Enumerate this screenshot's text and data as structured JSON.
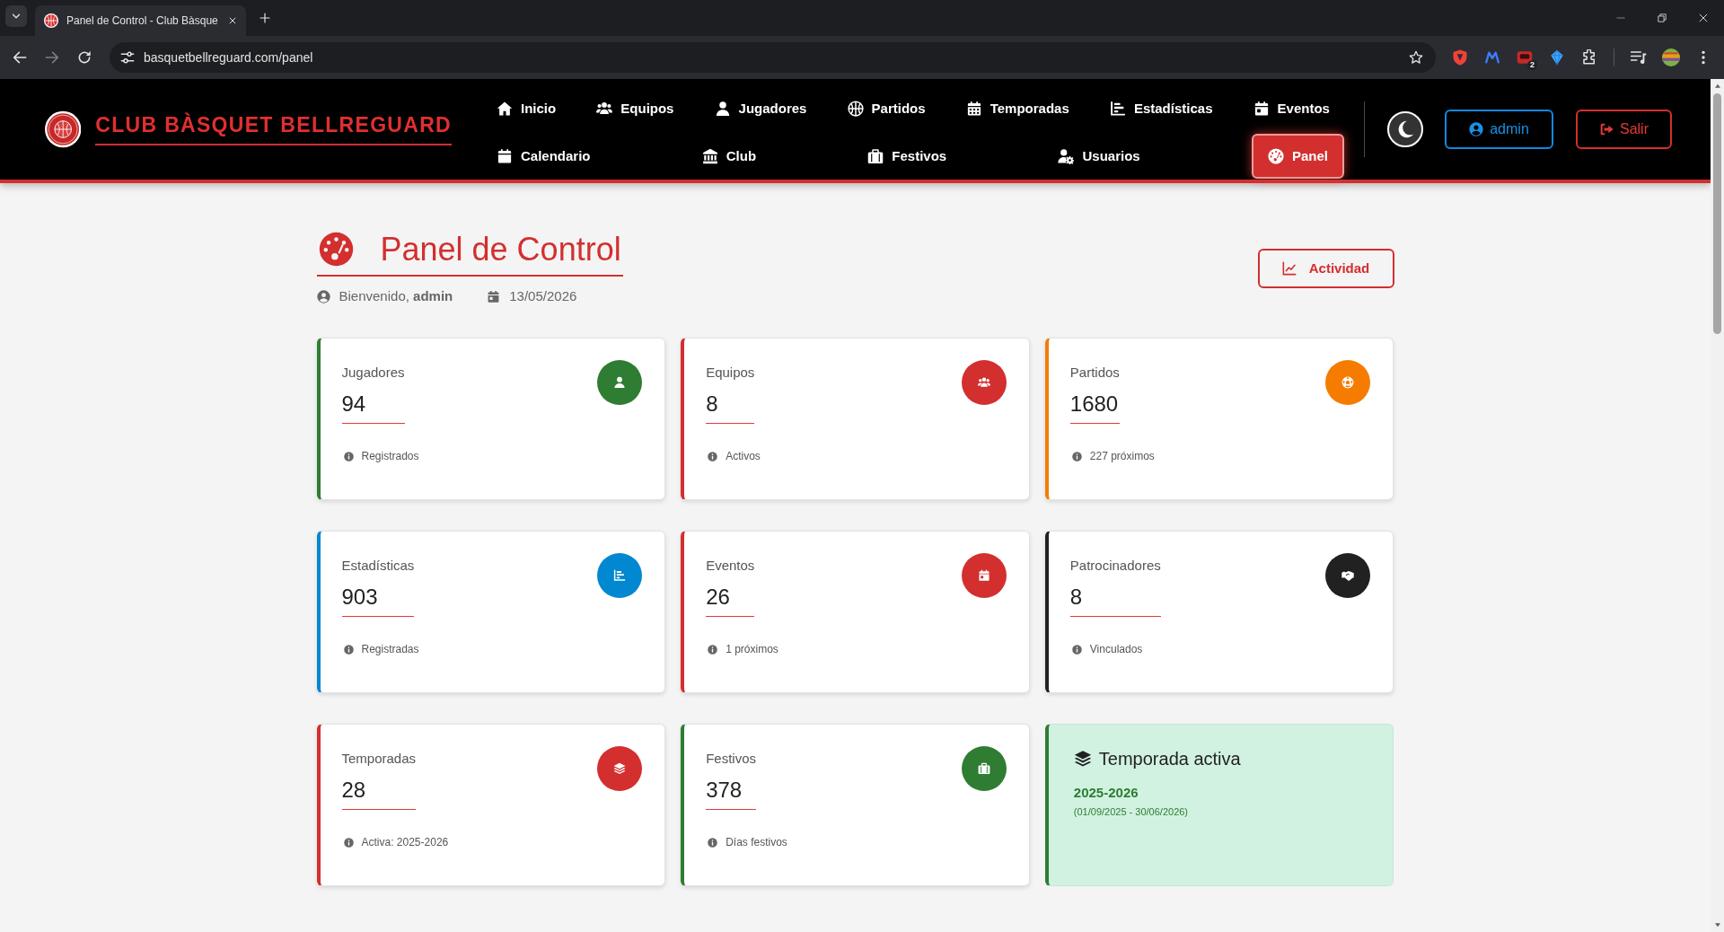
{
  "browser": {
    "tab_title": "Panel de Control - Club Bàsque",
    "url": "basquetbellreguard.com/panel",
    "extension_badge": "2"
  },
  "navbar": {
    "brand": "CLUB BÀSQUET BELLREGUARD",
    "rows": [
      {
        "items": [
          {
            "label": "Inicio",
            "selected": false
          },
          {
            "label": "Equipos",
            "selected": false
          },
          {
            "label": "Jugadores",
            "selected": false
          },
          {
            "label": "Partidos",
            "selected": false
          },
          {
            "label": "Temporadas",
            "selected": false
          },
          {
            "label": "Estadísticas",
            "selected": false
          },
          {
            "label": "Eventos",
            "selected": false
          }
        ]
      },
      {
        "items": [
          {
            "label": "Calendario",
            "selected": false
          },
          {
            "label": "Club",
            "selected": false
          },
          {
            "label": "Festivos",
            "selected": false
          },
          {
            "label": "Usuarios",
            "selected": false
          },
          {
            "label": "Panel",
            "selected": true
          }
        ]
      }
    ],
    "user_button": "admin",
    "logout_button": "Salir"
  },
  "header": {
    "title": "Panel de Control",
    "welcome": "Bienvenido, **admin**",
    "date": "13/05/2026",
    "activity_button": "Actividad"
  },
  "cards": [
    {
      "kind": "stat",
      "label": "Jugadores",
      "value": "94",
      "note": "Registrados",
      "color": "#2e7d32"
    },
    {
      "kind": "stat",
      "label": "Equipos",
      "value": "8",
      "note": "Activos",
      "color": "#d32f2f"
    },
    {
      "kind": "stat",
      "label": "Partidos",
      "value": "1680",
      "note": "227 próximos",
      "color": "#f57c00"
    },
    {
      "kind": "stat",
      "label": "Estadísticas",
      "value": "903",
      "note": "Registradas",
      "color": "#0288d1"
    },
    {
      "kind": "stat",
      "label": "Eventos",
      "value": "26",
      "note": "1 próximos",
      "color": "#d32f2f"
    },
    {
      "kind": "stat",
      "label": "Patrocinadores",
      "value": "8",
      "note": "Vinculados",
      "color": "#212121"
    },
    {
      "kind": "stat",
      "label": "Temporadas",
      "value": "28",
      "note": "Activa: 2025-2026",
      "color": "#d32f2f"
    },
    {
      "kind": "stat",
      "label": "Festivos",
      "value": "378",
      "note": "Días festivos",
      "color": "#2e7d32"
    },
    {
      "kind": "season",
      "title": "Temporada activa",
      "season": "2025-2026",
      "range": "(01/09/2025 - 30/06/2026)",
      "color": "#2e7d32"
    }
  ]
}
